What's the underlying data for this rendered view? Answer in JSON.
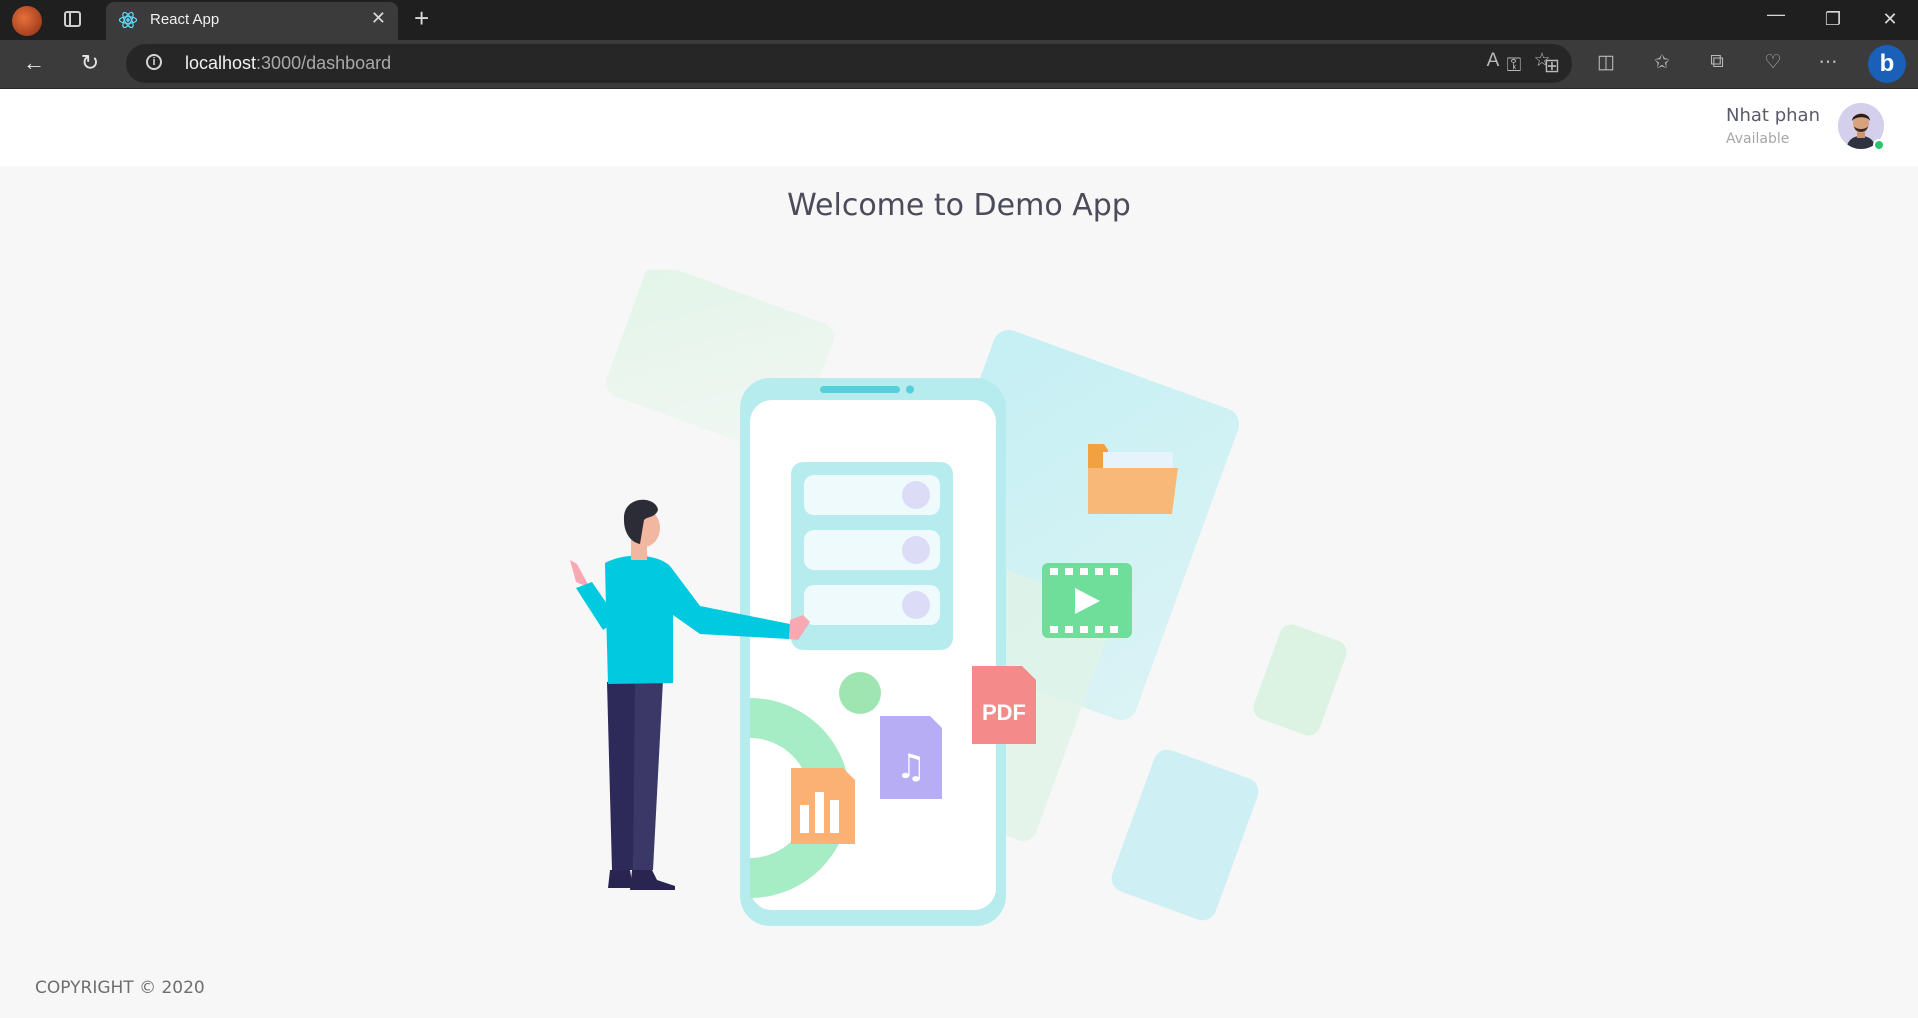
{
  "browser": {
    "tab_title": "React App",
    "url_host": "localhost",
    "url_path": ":3000/dashboard",
    "icons": [
      "profile-icon",
      "workspaces-icon",
      "react-favicon",
      "close-tab-icon",
      "new-tab-icon",
      "minimize-icon",
      "restore-icon",
      "close-window-icon",
      "back-icon",
      "refresh-icon",
      "info-icon",
      "key-icon",
      "apps-icon",
      "read-aloud-icon",
      "favorite-star-icon",
      "split-screen-icon",
      "favorites-icon",
      "collections-icon",
      "health-icon",
      "more-icon",
      "bing-icon"
    ]
  },
  "header": {
    "user_name": "Nhat phan",
    "user_status": "Available"
  },
  "main": {
    "welcome_title": "Welcome to Demo App",
    "illustration_labels": {
      "pdf": "PDF"
    }
  },
  "footer": {
    "copyright": "COPYRIGHT © 2020"
  },
  "colors": {
    "accent_cyan": "#00c9e0",
    "phone_frame": "#b7ecef",
    "folder_orange": "#f8b878",
    "video_green": "#6fde9a",
    "pdf_red": "#f48a8a",
    "music_purple": "#b6adf5",
    "chart_orange": "#fbb173",
    "presence_green": "#28c76f"
  }
}
